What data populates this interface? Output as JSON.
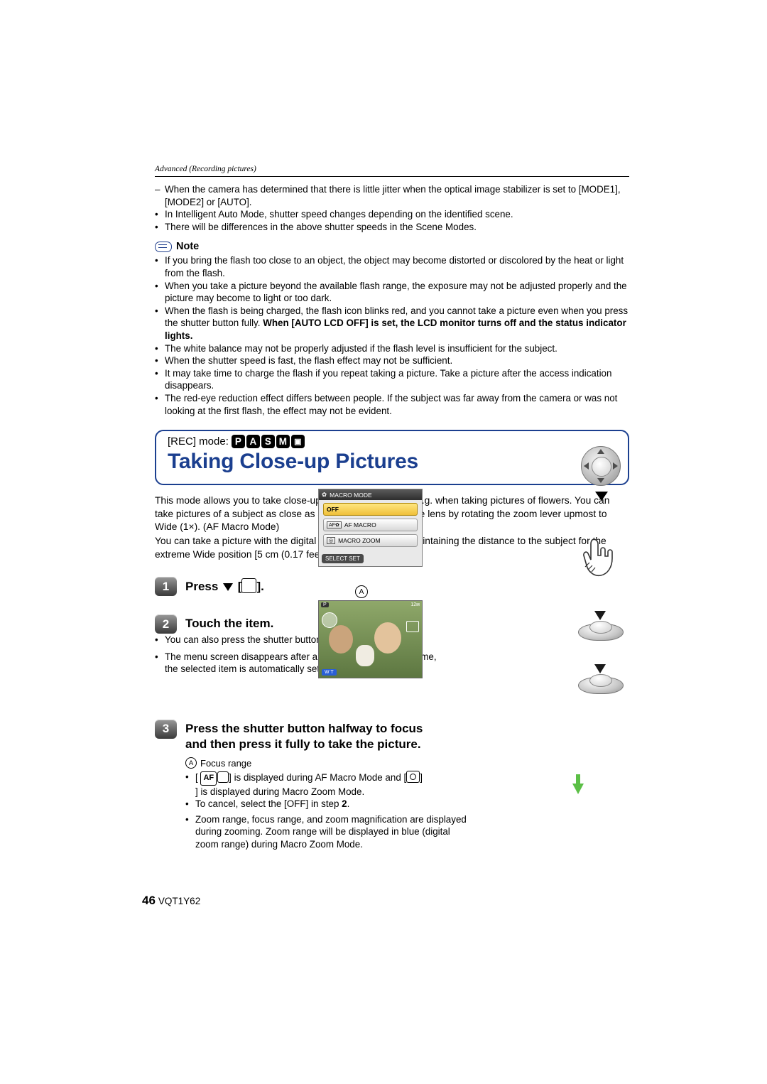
{
  "header": {
    "breadcrumb": "Advanced (Recording pictures)"
  },
  "intro": {
    "dash_item": "When the camera has determined that there is little jitter when the optical image stabilizer is set to [MODE1], [MODE2] or [AUTO].",
    "bullets": [
      "In Intelligent Auto Mode, shutter speed changes depending on the identified scene.",
      "There will be differences in the above shutter speeds in the Scene Modes."
    ]
  },
  "note": {
    "label": "Note",
    "items": [
      "If you bring the flash too close to an object, the object may become distorted or discolored by the heat or light from the flash.",
      "When you take a picture beyond the available flash range, the exposure may not be adjusted properly and the picture may become to light or too dark.",
      "When the flash is being charged, the flash icon blinks red, and you cannot take a picture even when you press the shutter button fully. ",
      "The white balance may not be properly adjusted if the flash level is insufficient for the subject.",
      "When the shutter speed is fast, the flash effect may not be sufficient.",
      "It may take time to charge the flash if you repeat taking a picture. Take a picture after the access indication disappears.",
      "The red-eye reduction effect differs between people. If the subject was far away from the camera or was not looking at the first flash, the effect may not be evident."
    ],
    "item3_bold": "When [AUTO LCD OFF] is set, the LCD monitor turns off and the status indicator lights."
  },
  "title_band": {
    "rec_mode_label": "[REC] mode:",
    "mode_icons": [
      "P",
      "A",
      "S",
      "M",
      "cam"
    ],
    "title": "Taking Close-up Pictures",
    "accent_color": "#1b3f8f"
  },
  "body": {
    "para1": "This mode allows you to take close-up pictures of a subject, e.g. when taking pictures of flowers. You can take pictures of a subject as close as 5 cm (0.17 feet) from the lens by rotating the zoom lever upmost to Wide (1×). (AF Macro Mode)",
    "para2": "You can take a picture with the digital zoom up to 3× while maintaining the distance to the subject for the extreme Wide position [5 cm (0.17 feet)]. (Macro Zoom Mode)"
  },
  "steps": [
    {
      "num": "1",
      "title_prefix": "Press",
      "title_suffix": "."
    },
    {
      "num": "2",
      "title": "Touch the item.",
      "bullets": [
        "You can also press the shutter button halfway to finish.",
        "The menu screen disappears after about 5 seconds. At this time, the selected item is automatically set."
      ]
    },
    {
      "num": "3",
      "title_line1": "Press the shutter button halfway to focus",
      "title_line2": "and then press it fully to take the picture.",
      "caption_a": "A",
      "caption_a_text": "Focus range",
      "bullets": [
        "] is displayed during AF Macro Mode and [",
        "] is displayed during Macro Zoom Mode.",
        "To cancel, select the [OFF] in step ",
        "Zoom range, focus range, and zoom magnification are displayed during zooming. Zoom range will be displayed in blue (digital zoom range) during Macro Zoom Mode."
      ],
      "af_icon_label": "AF",
      "step_ref": "2"
    }
  ],
  "macro_screen": {
    "title": "MACRO MODE",
    "rows": [
      "OFF",
      "AF MACRO",
      "MACRO ZOOM"
    ],
    "selected": "OFF",
    "footer": "SELECT     SET"
  },
  "photo_screen": {
    "mode_badge": "P",
    "resolution": "12м",
    "battery": "batt-icon",
    "zoom_bar": "W   T",
    "counter": ""
  },
  "footer": {
    "page": "46",
    "code": "VQT1Y62"
  }
}
